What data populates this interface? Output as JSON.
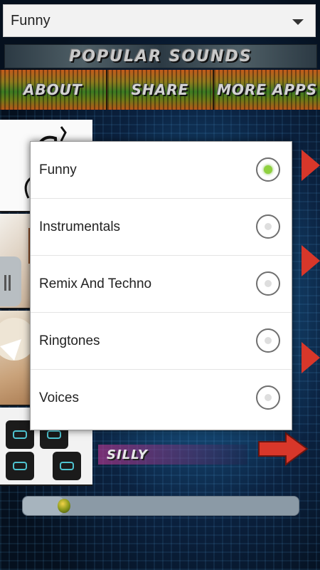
{
  "spinner": {
    "selected": "Funny"
  },
  "banners": {
    "popular": "POPULAR SOUNDS",
    "nav": [
      "ABOUT",
      "SHARE",
      "MORE APPS"
    ]
  },
  "list": {
    "visible_label": "SILLY"
  },
  "progress": {
    "fraction": 0.15
  },
  "dialog": {
    "options": [
      {
        "label": "Funny",
        "checked": true
      },
      {
        "label": "Instrumentals",
        "checked": false
      },
      {
        "label": "Remix And Techno",
        "checked": false
      },
      {
        "label": "Ringtones",
        "checked": false
      },
      {
        "label": "Voices",
        "checked": false
      }
    ]
  },
  "colors": {
    "radio_selected": "#8fd13f",
    "arrow_red": "#d8372a"
  },
  "icons": [
    "dropdown-arrow-icon",
    "radio-icon",
    "play-arrow-icon",
    "music-note-icon"
  ]
}
